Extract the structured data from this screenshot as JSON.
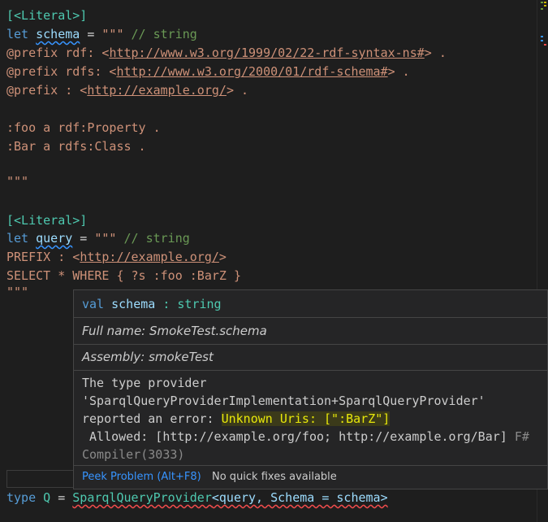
{
  "editor": {
    "l1": "[<Literal>]",
    "l2": {
      "kw": "let",
      "name": "schema",
      "eq": " = ",
      "str": "\"\"\"",
      "cmt": " // string"
    },
    "l3": {
      "p": "@prefix rdf: <",
      "url": "http://www.w3.org/1999/02/22-rdf-syntax-ns#",
      "e": "> ."
    },
    "l4": {
      "p": "@prefix rdfs: <",
      "url": "http://www.w3.org/2000/01/rdf-schema#",
      "e": "> ."
    },
    "l5": {
      "p": "@prefix : <",
      "url": "http://example.org/",
      "e": "> ."
    },
    "l7": ":foo a rdf:Property .",
    "l8": ":Bar a rdfs:Class .",
    "l10": "\"\"\"",
    "l12": "[<Literal>]",
    "l13": {
      "kw": "let",
      "name": "query",
      "eq": " = ",
      "str": "\"\"\"",
      "cmt": " // string"
    },
    "l14": {
      "p": "PREFIX : <",
      "url": "http://example.org/",
      "e": ">"
    },
    "l15": "SELECT * WHERE { ?s :foo :BarZ }",
    "l16": "\"\"\"",
    "last": {
      "kw": "type",
      "name": "Q",
      "eq": " = ",
      "provider": "SparqlQueryProvider",
      "args": "<query, Schema = schema>"
    }
  },
  "hover": {
    "sig_kw": "val",
    "sig_name": "schema",
    "sig_sep": " : ",
    "sig_type": "string",
    "full_name": "Full name: SmokeTest.schema",
    "assembly": "Assembly: smokeTest",
    "msg1": "The type provider",
    "msg2": "'SparqlQueryProviderImplementation+SparqlQueryProvider'",
    "msg3a": "reported an error: ",
    "msg3b": "Unknown Uris: [\":BarZ\"]",
    "msg4a": " Allowed: [http://example.org/foo; http://example.org/Bar]",
    "msg4b": " F#",
    "msg5": "Compiler(3033)",
    "peek": "Peek Problem (Alt+F8)",
    "nofix": "No quick fixes available"
  }
}
